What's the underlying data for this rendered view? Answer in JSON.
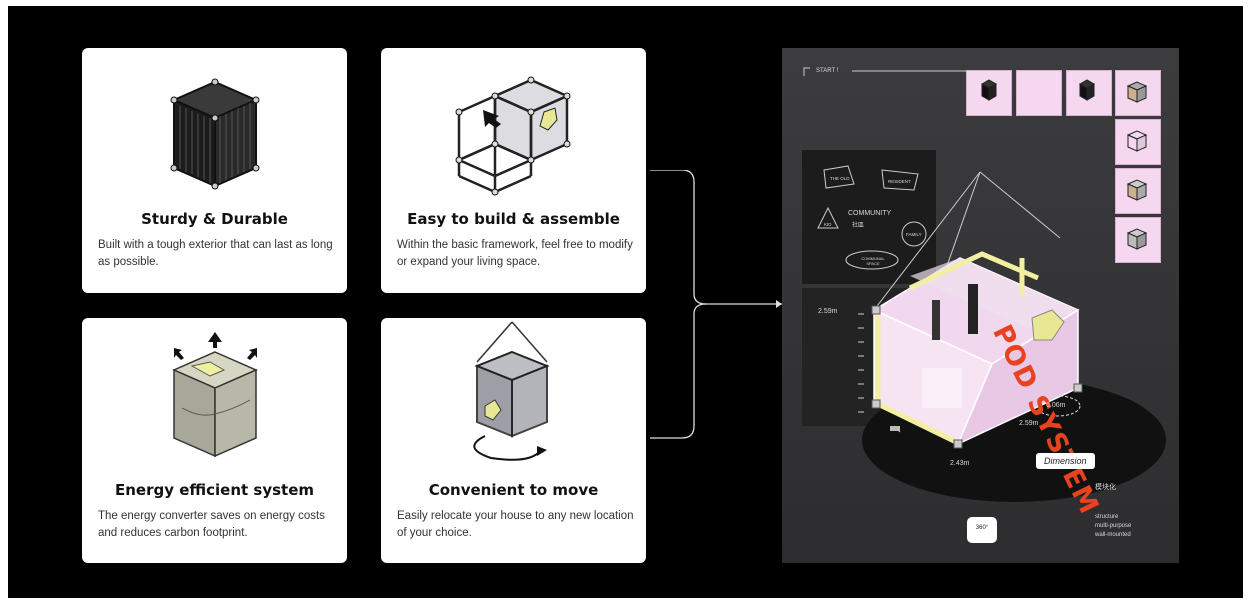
{
  "cards": [
    {
      "title": "Sturdy & Durable",
      "desc": "Built with a tough exterior that can last as long as possible.",
      "icon": "steel-cube-icon"
    },
    {
      "title": "Easy to build & assemble",
      "desc": "Within the basic framework, feel free to modify or expand your living space.",
      "icon": "frame-assembly-icon"
    },
    {
      "title": "Energy efficient system",
      "desc": "The energy converter saves on energy costs and reduces carbon footprint.",
      "icon": "energy-cube-icon"
    },
    {
      "title": "Convenient to move",
      "desc": "Easily relocate your house to any new location of your choice.",
      "icon": "hanging-cube-icon"
    }
  ],
  "poster": {
    "start_label": "START !",
    "title": "POD SYSTEM",
    "community_label": "COMMUNITY",
    "community_sub": "社區",
    "bubbles": [
      "THE OLD",
      "RESIDENT",
      "KID",
      "FAMILY",
      "COMMUNAL SPACE"
    ],
    "dimensions": {
      "height": "2.59m",
      "width": "2.59m",
      "depth": "2.43m",
      "area": "6.06m"
    },
    "dimension_badge": "Dimension",
    "module_title": "模块化",
    "module_items": [
      "structure",
      "multi-purpose",
      "wall-mounted"
    ],
    "rotate_label": "360°",
    "colors": {
      "accent": "#e8431f",
      "pink": "#f6d7f0",
      "yellow": "#f2f0a0"
    }
  }
}
